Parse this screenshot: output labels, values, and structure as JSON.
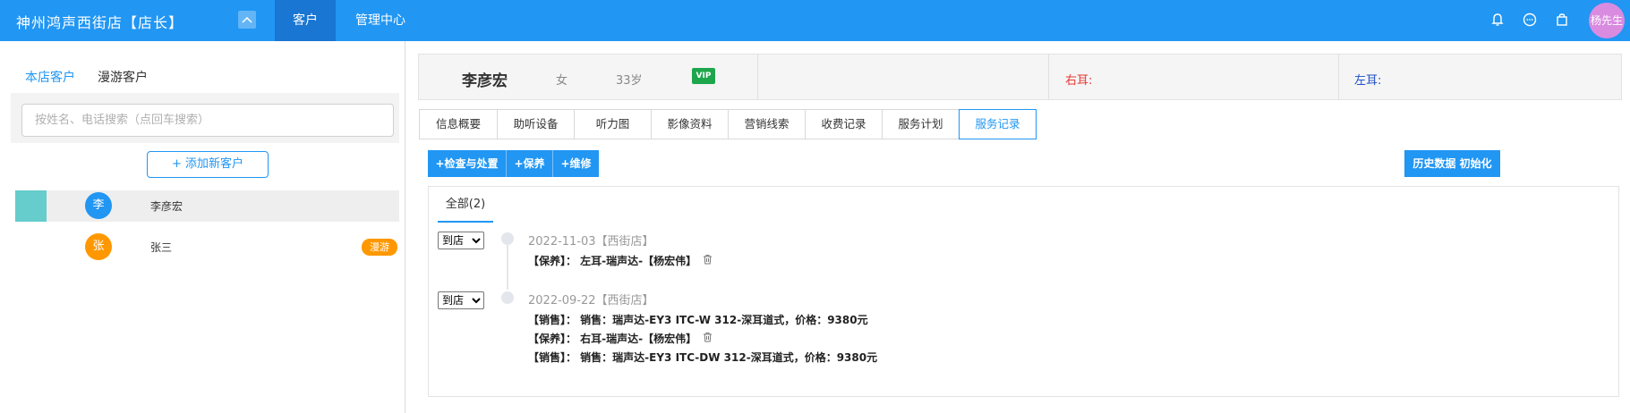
{
  "header": {
    "store_title": "神州鸿声西街店【店长】",
    "nav": [
      {
        "label": "客户",
        "active": true
      },
      {
        "label": "管理中心",
        "active": false
      }
    ],
    "user_label": "杨先生"
  },
  "sidebar": {
    "tabs": [
      {
        "label": "本店客户",
        "active": true
      },
      {
        "label": "漫游客户",
        "active": false
      }
    ],
    "search_placeholder": "按姓名、电话搜索（点回车搜索）",
    "add_button": "+ 添加新客户",
    "customers": [
      {
        "initial": "李",
        "name": "李彦宏",
        "avatar_color": "#2196f3",
        "selected": true,
        "badge": ""
      },
      {
        "initial": "张",
        "name": "张三",
        "avatar_color": "#ff9800",
        "selected": false,
        "badge": "漫游"
      }
    ]
  },
  "customer": {
    "name": "李彦宏",
    "gender": "女",
    "age": "33岁",
    "vip": "VIP",
    "right_ear_label": "右耳:",
    "left_ear_label": "左耳:"
  },
  "detail_tabs": [
    {
      "label": "信息概要"
    },
    {
      "label": "助听设备"
    },
    {
      "label": "听力图"
    },
    {
      "label": "影像资料"
    },
    {
      "label": "营销线索"
    },
    {
      "label": "收费记录"
    },
    {
      "label": "服务计划"
    },
    {
      "label": "服务记录",
      "active": true
    }
  ],
  "actions": {
    "check": "+检查与处置",
    "maintain": "+保养",
    "repair": "+维修",
    "init_history": "历史数据 初始化"
  },
  "records": {
    "tab_all": "全部(2)",
    "status_options": [
      "到店"
    ],
    "entries": [
      {
        "date": "2022-11-03【西街店】",
        "lines": [
          {
            "text": "【保养】： 左耳-瑞声达-【杨宏伟】",
            "deletable": true
          }
        ]
      },
      {
        "date": "2022-09-22【西街店】",
        "lines": [
          {
            "text": "【销售】： 销售：瑞声达-EY3 ITC-W 312-深耳道式，价格：9380元",
            "deletable": false
          },
          {
            "text": "【保养】： 右耳-瑞声达-【杨宏伟】",
            "deletable": true
          },
          {
            "text": "【销售】： 销售：瑞声达-EY3 ITC-DW 312-深耳道式，价格：9380元",
            "deletable": false
          }
        ]
      }
    ]
  }
}
